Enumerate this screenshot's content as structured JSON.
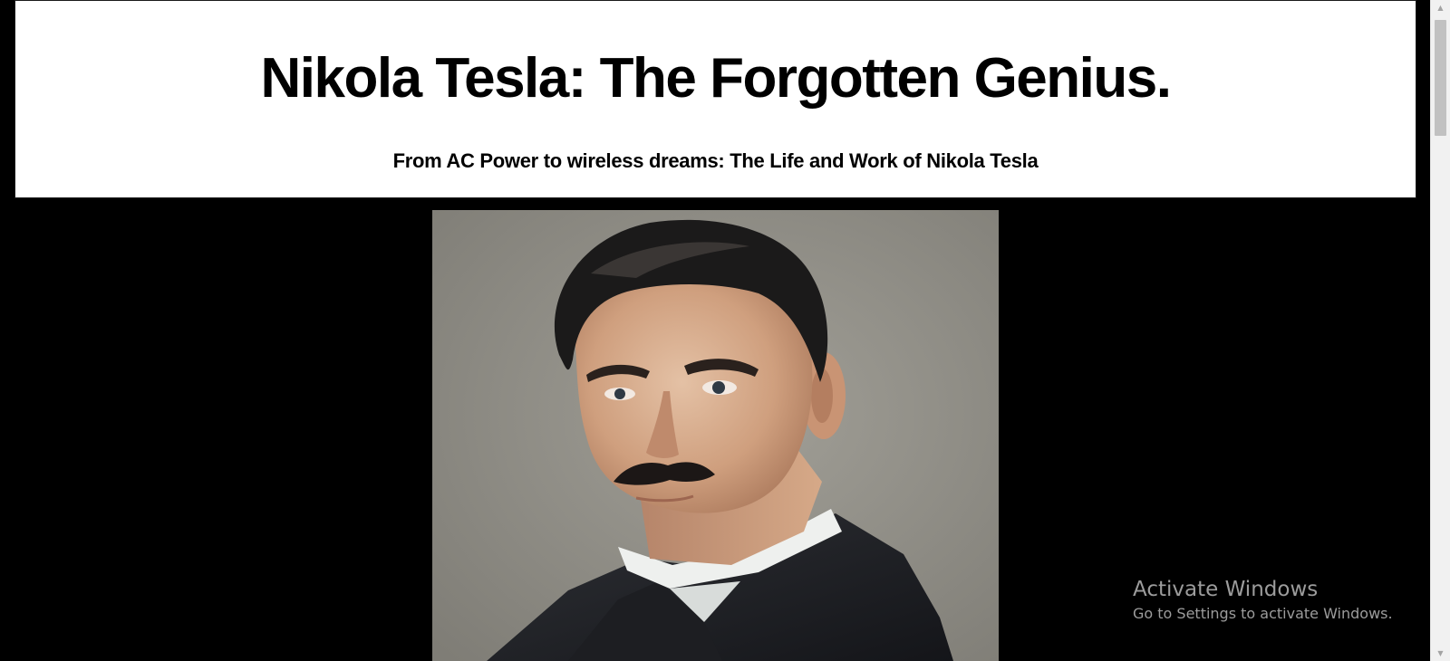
{
  "header": {
    "title": "Nikola Tesla: The Forgotten Genius.",
    "subtitle": "From AC Power to wireless dreams: The Life and Work of Nikola Tesla"
  },
  "portrait": {
    "subject": "tesla-portrait-photo"
  },
  "watermark": {
    "title": "Activate Windows",
    "subtitle": "Go to Settings to activate Windows."
  },
  "colors": {
    "page_background": "#000000",
    "header_background": "#ffffff",
    "text": "#000000",
    "watermark_text": "#9c9c9c"
  }
}
